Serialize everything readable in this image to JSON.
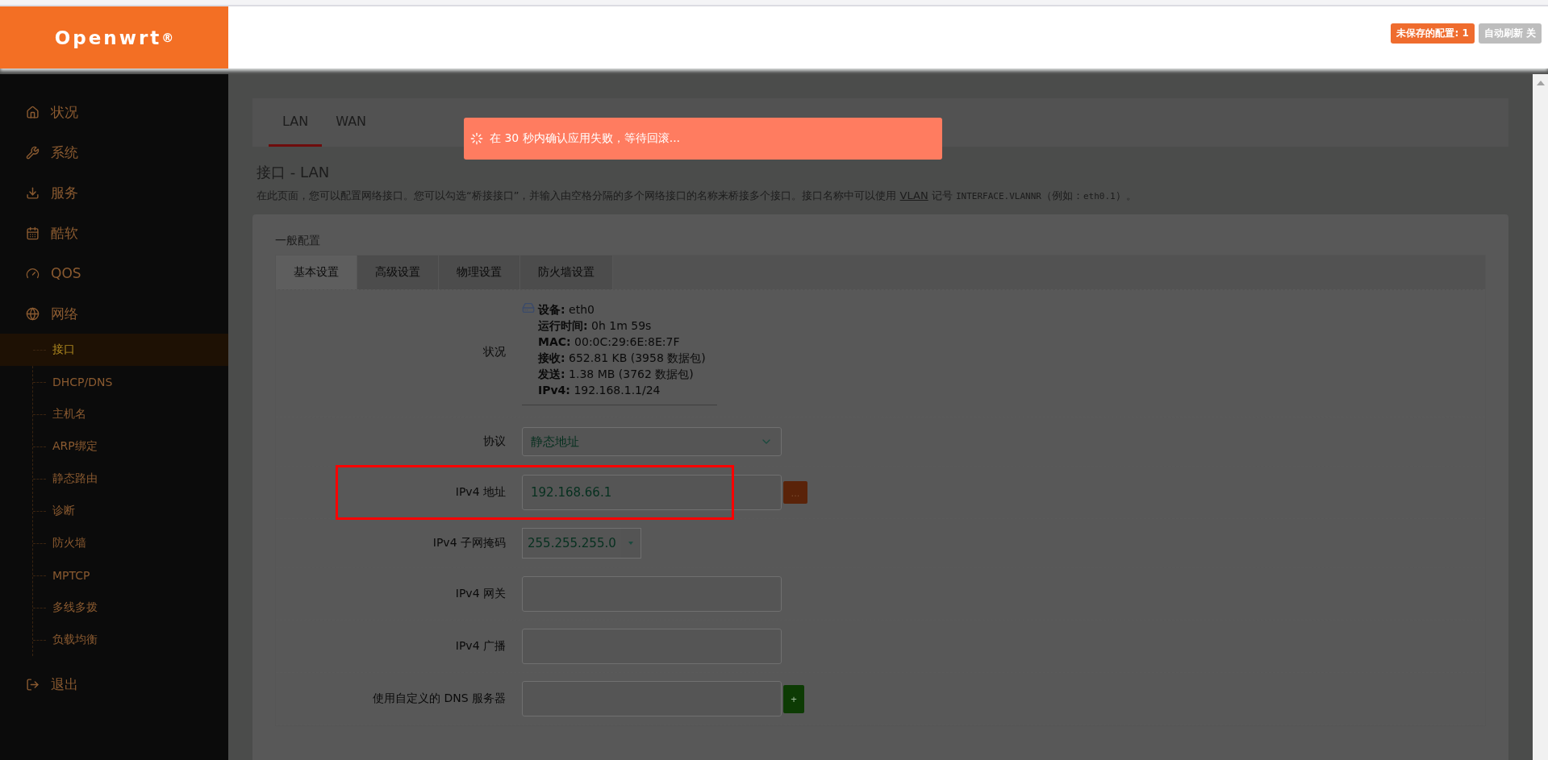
{
  "logo": {
    "text": "Openwrt",
    "mark": "®"
  },
  "header": {
    "badges": [
      {
        "kind": "unsaved",
        "label": "未保存的配置: 1"
      },
      {
        "kind": "refresh",
        "label": "自动刷新 关"
      }
    ]
  },
  "sidebar": {
    "items": [
      {
        "label": "状况",
        "selected": false
      },
      {
        "label": "系统",
        "selected": false
      },
      {
        "label": "服务",
        "selected": false
      },
      {
        "label": "酷软",
        "selected": false
      },
      {
        "label": "QOS",
        "selected": false
      },
      {
        "label": "网络",
        "selected": false,
        "children": [
          {
            "label": "接口",
            "selected": true
          },
          {
            "label": "DHCP/DNS",
            "selected": false
          },
          {
            "label": "主机名",
            "selected": false
          },
          {
            "label": "ARP绑定",
            "selected": false
          },
          {
            "label": "静态路由",
            "selected": false
          },
          {
            "label": "诊断",
            "selected": false
          },
          {
            "label": "防火墙",
            "selected": false
          },
          {
            "label": "MPTCP",
            "selected": false
          },
          {
            "label": "多线多拨",
            "selected": false
          },
          {
            "label": "负载均衡",
            "selected": false
          }
        ]
      },
      {
        "label": "退出",
        "selected": false
      }
    ]
  },
  "tabs": [
    {
      "label": "LAN",
      "selected": true
    },
    {
      "label": "WAN",
      "selected": false
    }
  ],
  "toast": {
    "message": "在 30 秒内确认应用失败，等待回滚..."
  },
  "page": {
    "title": "接口 - LAN",
    "description": [
      {
        "kind": "text",
        "text": "在此页面，您可以配置网络接口。您可以勾选“桥接接口”，并输入由空格分隔的多个网络接口的名称来桥接多个接口。接口名称中可以使用 "
      },
      {
        "kind": "link",
        "text": "VLAN"
      },
      {
        "kind": "text",
        "text": " 记号 "
      },
      {
        "kind": "code",
        "text": "INTERFACE.VLANNR"
      },
      {
        "kind": "text",
        "text": "（例如："
      },
      {
        "kind": "code",
        "text": "eth0.1"
      },
      {
        "kind": "text",
        "text": "）。"
      }
    ]
  },
  "section": {
    "title": "一般配置",
    "tabs": [
      {
        "label": "基本设置",
        "selected": true
      },
      {
        "label": "高级设置",
        "selected": false
      },
      {
        "label": "物理设置",
        "selected": false
      },
      {
        "label": "防火墙设置",
        "selected": false
      }
    ],
    "rows": [
      {
        "kind": "status",
        "label": "状况",
        "lines": [
          "**设备:** eth0",
          "**运行时间:** 0h 1m 59s",
          "**MAC:** 00:0C:29:6E:8E:7F",
          "**接收:** 652.81 KB (3958 数据包)",
          "**发送:** 1.38 MB (3762 数据包)",
          "**IPv4:** 192.168.1.1/24"
        ]
      },
      {
        "kind": "select",
        "label": "协议",
        "value": "静态地址"
      },
      {
        "kind": "input",
        "label": "IPv4 地址",
        "value": "192.168.66.1",
        "button": "...",
        "highlighted": true
      },
      {
        "kind": "combo",
        "label": "IPv4 子网掩码",
        "value": "255.255.255.0"
      },
      {
        "kind": "input",
        "label": "IPv4 网关",
        "value": ""
      },
      {
        "kind": "input",
        "label": "IPv4 广播",
        "value": ""
      },
      {
        "kind": "input",
        "label": "使用自定义的 DNS 服务器",
        "value": "",
        "button": "+"
      }
    ]
  }
}
